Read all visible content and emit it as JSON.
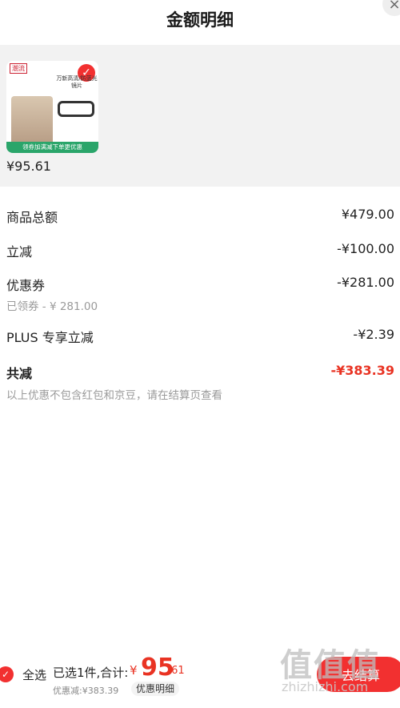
{
  "header": {
    "title": "金额明细",
    "close": "×"
  },
  "product": {
    "brand": "潮流",
    "ad_text": "万新高清/防蓝光镜片",
    "banner": "领券加满减下单更优惠",
    "price": "¥95.61"
  },
  "breakdown": {
    "total_goods": {
      "label": "商品总额",
      "value": "¥479.00"
    },
    "instant_cut": {
      "label": "立减",
      "value": "-¥100.00"
    },
    "coupon": {
      "label": "优惠券",
      "value": "-¥281.00",
      "note": "已领券 - ¥ 281.00"
    },
    "plus_cut": {
      "label": "PLUS 专享立减",
      "value": "-¥2.39"
    },
    "total_cut": {
      "label": "共减",
      "value": "-¥383.39",
      "note": "以上优惠不包含红包和京豆，请在结算页查看"
    }
  },
  "bottom_bar": {
    "select_all": "全选",
    "summary": "已选1件,合计:",
    "yen": "¥",
    "price_int": "95",
    "price_dec": ".61",
    "discount": "优惠减:¥383.39",
    "detail_button": "优惠明细",
    "checkout": "去结算"
  },
  "watermark": {
    "logo": "值值值",
    "site": "zhizhizhi.com"
  },
  "colors": {
    "accent": "#f23030",
    "price_red": "#e93323"
  }
}
